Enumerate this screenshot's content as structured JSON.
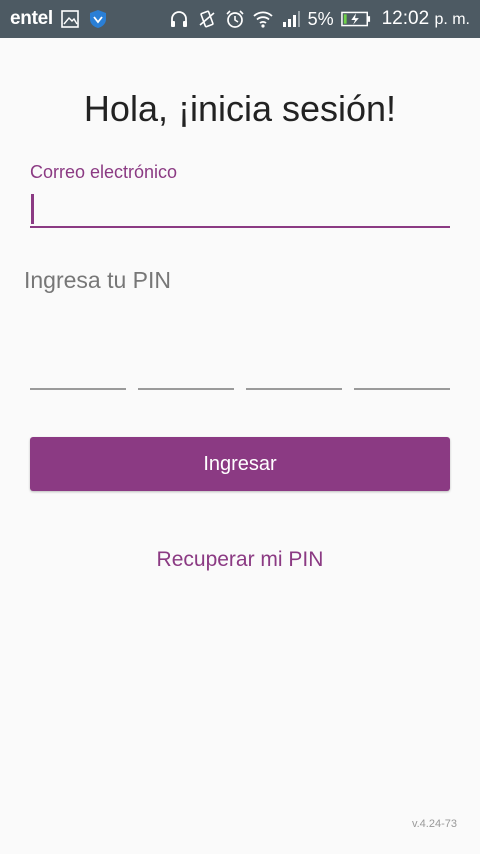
{
  "status_bar": {
    "carrier": "entel",
    "battery_percent": "5%",
    "time": "12:02",
    "time_suffix": "p. m.",
    "icons": [
      "image-icon",
      "shield-icon",
      "headphones-icon",
      "vibrate-icon",
      "alarm-icon",
      "wifi-icon",
      "signal-icon",
      "battery-charging-icon"
    ]
  },
  "login": {
    "title": "Hola, ¡inicia sesión!",
    "email_label": "Correo electrónico",
    "email_value": "",
    "pin_label": "Ingresa tu PIN",
    "pin_digits": [
      "",
      "",
      "",
      ""
    ],
    "submit_label": "Ingresar",
    "recover_label": "Recuperar mi PIN",
    "version": "v.4.24-73"
  },
  "colors": {
    "accent": "#8b3a83",
    "status_bar": "#4d5a63",
    "background": "#fafafa"
  }
}
